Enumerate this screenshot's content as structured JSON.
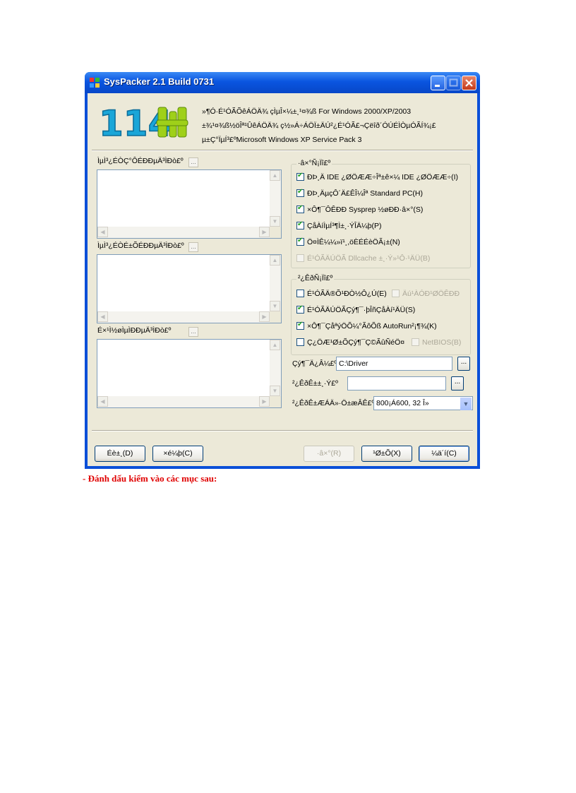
{
  "window": {
    "title": "SysPacker 2.1 Build 0731"
  },
  "header": {
    "logo_text": "114",
    "desc_lines": [
      "»¶Ó·É¹ÓÃÕêÁÖÄ¾ çÌµÎ×¼±¸¹¤¾ß For Windows 2000/XP/2003",
      "±¾¹¤¾ß½öÎª¹ÛêÁÖÄ¾ ç½»Á÷ÁÖÏ±ÄÚ²¿É¹ÓÃ£¬Çëîð´ÓÚÉÌÒµÓÃÍ¾¡£",
      "µ±Ç°ÏµÍ³£ºMicrosoft Windows XP Service Pack 3"
    ]
  },
  "left": {
    "label1": "ÌµÌ³¿ÉÒÇ°ÔÉÐÐµÄ³ÌÐò£º",
    "label2": "ÌµÌ³¿ÉÒÉ±ÕÉÐÐµÄ³ÌÐò£º",
    "label3": "É×¹Ì½øÌµÌÐÐµÄ³ÌÐò£º",
    "add_btn": "..."
  },
  "options": {
    "label": "·â×°Ñ¡Ïî£º",
    "items": [
      {
        "label": "ÐÞ¸Ä IDE ¿ØÖÆÆ÷Îª±ê×¼ IDE ¿ØÖÆÆ÷(I)",
        "checked": true,
        "disabled": false
      },
      {
        "label": "ÐÞ¸ÄµçÔ´Ä£ÊÎ¼Îª Standard PC(H)",
        "checked": true,
        "disabled": false
      },
      {
        "label": "×Ô¶¯ÔÊÐÐ Sysprep ½øÐÐ·â×°(S)",
        "checked": true,
        "disabled": false
      },
      {
        "label": "ÇåÀíÌµÍ³¶Ì±¸·ÝÎÄ¼þ(P)",
        "checked": true,
        "disabled": false
      },
      {
        "label": "Ö¤ÌÊ¼¼»ï¹¸,öÈÉÉèÖÃ¡±(N)",
        "checked": true,
        "disabled": false
      },
      {
        "label": "É¹ÓÃÄÚÖÃ Dllcache ±¸·Ý»¹Ô·¹ÄÜ(B)",
        "checked": false,
        "disabled": true
      }
    ]
  },
  "deploy": {
    "label": "²¿ÊðÑ¡Ïî£º",
    "items": [
      {
        "label": "É¹ÓÃÄ®Õ¹ÐÒ½Ô¿Ú(E)",
        "checked": false,
        "disabled": false
      },
      {
        "label": "Äú¹ÀÓÐ¹ØÖÊÐÐ",
        "checked": false,
        "disabled": true
      },
      {
        "label": "É¹ÓÃÄÚÖÃÇý¶¯·þÎñÇåÀí¹ÄÜ(S)",
        "checked": true,
        "disabled": false
      },
      {
        "label": "×Ô¶¯ÇåªýÖÕ¼°ÃôÕß AutoRun²¡¶¾(K)",
        "checked": true,
        "disabled": false
      },
      {
        "label": "Ç¿ÖÆ¹Ø±ÕÇý¶¯Ç©ÃûÑéÖ¤",
        "checked": false,
        "disabled": false
      },
      {
        "label": "NetBIOS(B)",
        "checked": false,
        "disabled": true
      }
    ]
  },
  "fields": {
    "driver_label": "Çý¶¯Ä¿Â¼£º",
    "driver_value": "C:\\Driver",
    "backup_label": "²¿ÊðÊ±±¸·Ý£º",
    "backup_value": "",
    "resolution_label": "²¿ÊðÊ±ÆÁÄ»·Ö±æÂÊ£º",
    "resolution_value": "800¡Á600, 32 Î»",
    "browse": "..."
  },
  "buttons": {
    "help": "Éè±¸(D)",
    "about": "×é¼þ(C)",
    "pack": "·â×°(R)",
    "exit": "¹Ø±Õ(X)",
    "cancel": "¼ä´í(C)"
  },
  "caption": "- Đánh dấu kiểm vào các mục  sau:",
  "colors": {
    "titlebar": "#0a55e0",
    "client_bg": "#ece9d8",
    "caption_red": "#e00000"
  }
}
